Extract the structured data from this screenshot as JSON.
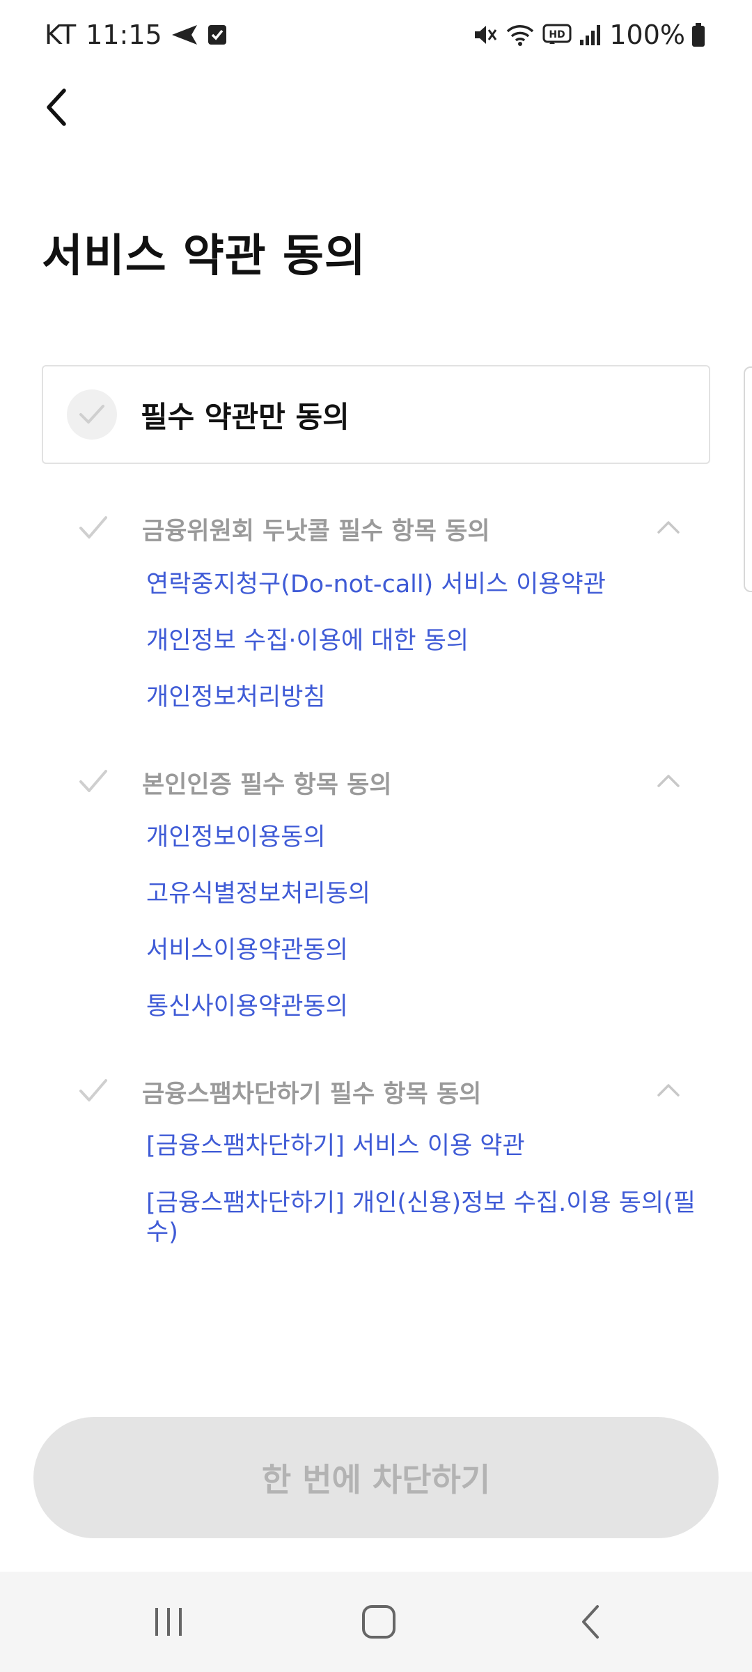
{
  "status_bar": {
    "carrier": "KT",
    "time": "11:15",
    "battery": "100%"
  },
  "header": {
    "title": "서비스 약관 동의"
  },
  "agree_all": {
    "label": "필수 약관만 동의"
  },
  "sections": [
    {
      "title": "금융위원회 두낫콜 필수 항목 동의",
      "items": [
        "연락중지청구(Do-not-call) 서비스 이용약관",
        "개인정보 수집·이용에 대한 동의",
        "개인정보처리방침"
      ]
    },
    {
      "title": "본인인증 필수 항목 동의",
      "items": [
        "개인정보이용동의",
        "고유식별정보처리동의",
        "서비스이용약관동의",
        "통신사이용약관동의"
      ]
    },
    {
      "title": "금융스팸차단하기 필수 항목 동의",
      "items": [
        "[금융스팸차단하기] 서비스 이용 약관",
        "[금융스팸차단하기] 개인(신용)정보 수집.이용 동의(필",
        "수)"
      ]
    }
  ],
  "footer": {
    "block_button_label": "한 번에 차단하기"
  },
  "colors": {
    "link": "#3f5bd6",
    "muted": "#9a9a9a",
    "button_disabled_bg": "#e4e4e4"
  }
}
